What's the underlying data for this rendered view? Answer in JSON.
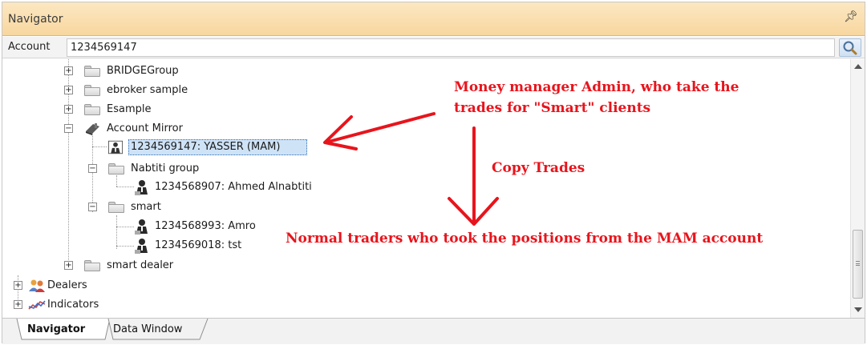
{
  "window": {
    "title": "Navigator",
    "pin_icon": "pin-icon"
  },
  "account": {
    "label": "Account",
    "value": "1234569147",
    "search_icon": "magnifier-icon"
  },
  "tree": {
    "groups_top": [
      {
        "label": "BRIDGEGroup",
        "expander": "+"
      },
      {
        "label": "ebroker sample",
        "expander": "+"
      },
      {
        "label": "Esample",
        "expander": "+"
      }
    ],
    "account_mirror": {
      "label": "Account Mirror",
      "expander": "−",
      "selected_item": "1234569147: YASSER (MAM)",
      "subgroups": [
        {
          "label": "Nabtiti group",
          "expander": "−",
          "accounts": [
            "1234568907: Ahmed Alnabtiti"
          ]
        },
        {
          "label": "smart",
          "expander": "−",
          "accounts": [
            "1234568993: Amro",
            "1234569018: tst"
          ]
        }
      ],
      "after": {
        "label": "smart dealer",
        "expander": "+"
      }
    },
    "root_items": [
      {
        "label": "Dealers",
        "expander": "+",
        "icon": "dealers-icon"
      },
      {
        "label": "Indicators",
        "expander": "+",
        "icon": "indicators-icon"
      }
    ]
  },
  "tabs": [
    {
      "label": "Navigator",
      "active": true
    },
    {
      "label": "Data Window",
      "active": false
    }
  ],
  "annotations": {
    "manager_line1": "Money manager Admin, who take the",
    "manager_line2": "trades for \"Smart\" clients",
    "copy": "Copy Trades",
    "normal": "Normal traders who took the positions from the MAM account",
    "color": "#e8141c"
  },
  "colors": {
    "titlebar": "#f8d79f",
    "selection": "#cfe3f7"
  }
}
